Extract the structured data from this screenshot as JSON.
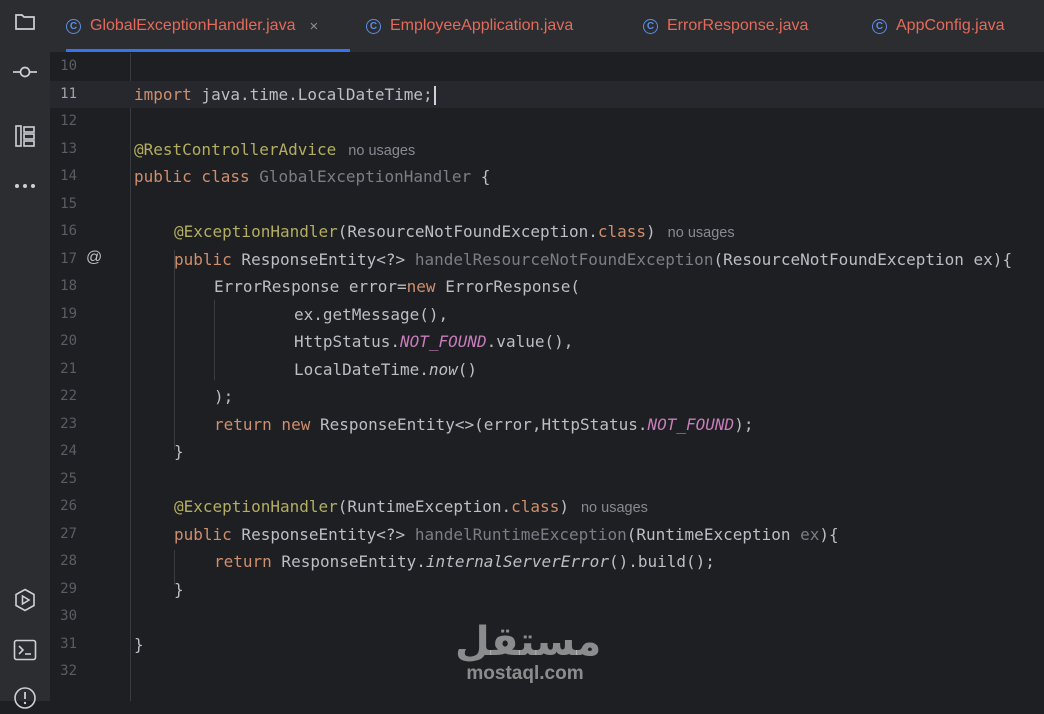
{
  "tabs": [
    {
      "label": "GlobalExceptionHandler.java",
      "active": true
    },
    {
      "label": "EmployeeApplication.java",
      "active": false
    },
    {
      "label": "ErrorResponse.java",
      "active": false
    },
    {
      "label": "AppConfig.java",
      "active": false
    }
  ],
  "tab_icon_letter": "C",
  "close_glyph": "×",
  "sidebar_icons": [
    "folder-icon",
    "commit-icon",
    "structure-icon",
    "more-icon",
    "run-icon",
    "terminal-icon",
    "problems-icon"
  ],
  "gutter_marker": "@",
  "hints": {
    "no_usages": "no usages"
  },
  "lines": [
    {
      "n": "10"
    },
    {
      "n": "11",
      "t1": "import",
      "t2": " java.time.LocalDateTime;"
    },
    {
      "n": "12"
    },
    {
      "n": "13",
      "t1": "@RestControllerAdvice"
    },
    {
      "n": "14",
      "t1": "public class",
      "t2": " GlobalExceptionHandler",
      "t3": " {"
    },
    {
      "n": "15"
    },
    {
      "n": "16",
      "t1": "@ExceptionHandler",
      "t2": "(ResourceNotFoundException.",
      "t3": "class",
      "t4": ")"
    },
    {
      "n": "17",
      "t1": "public",
      "t2": " ResponseEntity<?> ",
      "t3": "handelResourceNotFoundException",
      "t4": "(ResourceNotFoundException ex){"
    },
    {
      "n": "18",
      "t1": "ErrorResponse error=",
      "t2": "new",
      "t3": " ErrorResponse("
    },
    {
      "n": "19",
      "t1": "ex.getMessage(),"
    },
    {
      "n": "20",
      "t1": "HttpStatus.",
      "t2": "NOT_FOUND",
      "t3": ".value(),"
    },
    {
      "n": "21",
      "t1": "LocalDateTime.",
      "t2": "now",
      "t3": "()"
    },
    {
      "n": "22",
      "t1": ");"
    },
    {
      "n": "23",
      "t1": "return new",
      "t2": " ResponseEntity<>(error,HttpStatus.",
      "t3": "NOT_FOUND",
      "t4": ");"
    },
    {
      "n": "24",
      "t1": "}"
    },
    {
      "n": "25"
    },
    {
      "n": "26",
      "t1": "@ExceptionHandler",
      "t2": "(RuntimeException.",
      "t3": "class",
      "t4": ")"
    },
    {
      "n": "27",
      "t1": "public",
      "t2": " ResponseEntity<?> ",
      "t3": "handelRuntimeException",
      "t4": "(RuntimeException ",
      "t5": "ex",
      "t6": "){"
    },
    {
      "n": "28",
      "t1": "return",
      "t2": " ResponseEntity.",
      "t3": "internalServerError",
      "t4": "().build();"
    },
    {
      "n": "29",
      "t1": "}"
    },
    {
      "n": "30"
    },
    {
      "n": "31",
      "t1": "}"
    },
    {
      "n": "32"
    }
  ],
  "watermark": {
    "arabic": "مستقل",
    "latin": "mostaql.com"
  }
}
